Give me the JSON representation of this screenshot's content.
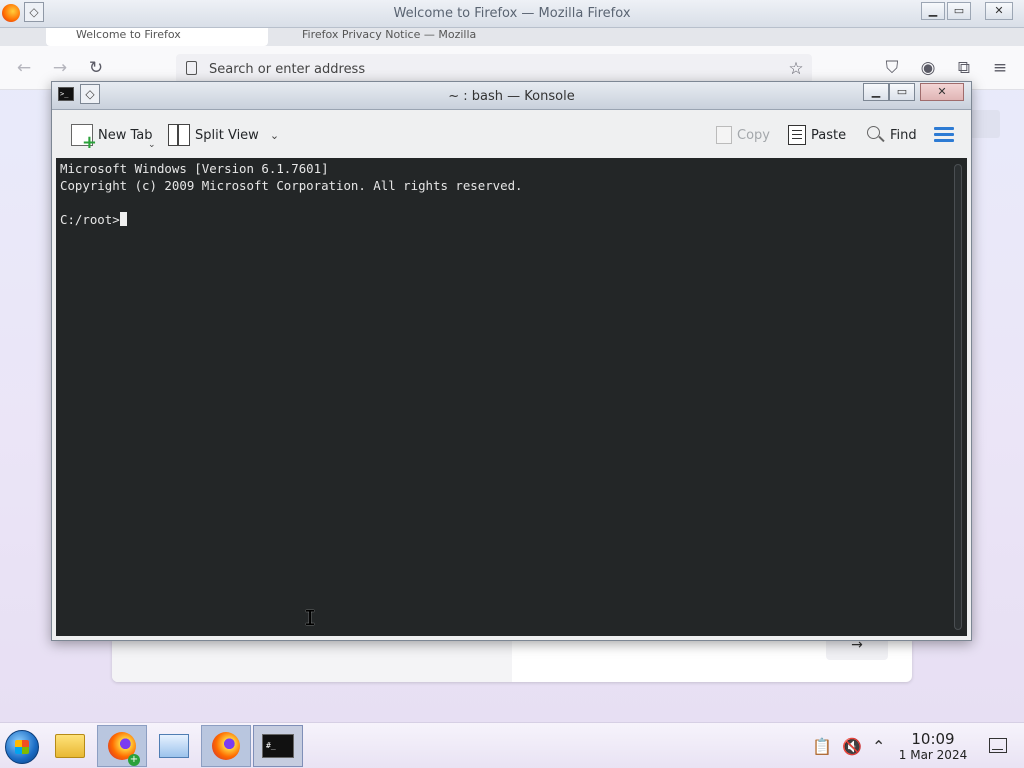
{
  "firefox": {
    "window_title": "Welcome to Firefox — Mozilla Firefox",
    "tab_1": "Welcome to Firefox",
    "tab_2": "Firefox Privacy Notice — Mozilla",
    "address_placeholder": "Search or enter address",
    "minimize": "▁",
    "maximize": "▭",
    "close": "✕"
  },
  "konsole": {
    "window_title": "~ : bash — Konsole",
    "toolbar": {
      "new_tab": "New Tab",
      "split_view": "Split View",
      "copy": "Copy",
      "paste": "Paste",
      "find": "Find"
    },
    "terminal": {
      "line1": "Microsoft Windows [Version 6.1.7601]",
      "line2": "Copyright (c) 2009 Microsoft Corporation. All rights reserved.",
      "prompt": "C:/root>"
    }
  },
  "taskbar": {
    "time": "10:09",
    "date": "1 Mar 2024"
  },
  "icons": [
    "firefox-icon",
    "pin-icon",
    "konsole-icon",
    "new-tab-icon",
    "split-view-icon",
    "copy-icon",
    "paste-icon",
    "find-icon",
    "hamburger-menu-icon",
    "start-icon",
    "file-manager-icon",
    "remote-desktop-icon",
    "terminal-icon",
    "clipboard-icon",
    "volume-muted-icon",
    "chevron-up-icon",
    "notifications-icon"
  ]
}
